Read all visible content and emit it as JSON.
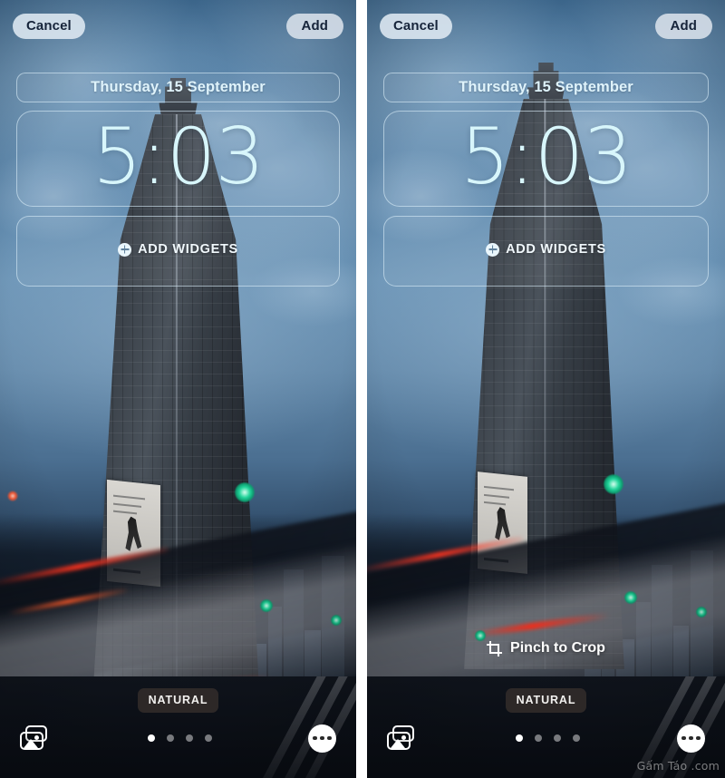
{
  "panels": [
    {
      "id": "left",
      "topbar": {
        "cancel_label": "Cancel",
        "add_label": "Add"
      },
      "date_widget": {
        "text": "Thursday, 15 September"
      },
      "clock_widget": {
        "time": "5:03"
      },
      "add_widgets": {
        "label": "ADD WIDGETS",
        "icon": "plus-circle-icon"
      },
      "pinch_to_crop": {
        "visible": false,
        "label": "Pinch to Crop",
        "icon": "crop-icon"
      },
      "style_badge": {
        "label": "NATURAL"
      },
      "bottom_bar": {
        "photo_library_icon": "photo-library-icon",
        "more_icon": "ellipsis-icon",
        "page_dots": {
          "count": 4,
          "active_index": 0
        }
      },
      "watermark": ""
    },
    {
      "id": "right",
      "topbar": {
        "cancel_label": "Cancel",
        "add_label": "Add"
      },
      "date_widget": {
        "text": "Thursday, 15 September"
      },
      "clock_widget": {
        "time": "5:03"
      },
      "add_widgets": {
        "label": "ADD WIDGETS",
        "icon": "plus-circle-icon"
      },
      "pinch_to_crop": {
        "visible": true,
        "label": "Pinch to Crop",
        "icon": "crop-icon"
      },
      "style_badge": {
        "label": "NATURAL"
      },
      "bottom_bar": {
        "photo_library_icon": "photo-library-icon",
        "more_icon": "ellipsis-icon",
        "page_dots": {
          "count": 4,
          "active_index": 0
        }
      },
      "watermark": "Gấm Táo .com"
    }
  ],
  "colors": {
    "sky_blue": "#5d89ae",
    "clock_text": "#d8f6fb",
    "widget_border": "#d6eaf6",
    "pill_bg": "#dfe9f2",
    "pill_text": "#16243a",
    "badge_bg": "#3a322e",
    "accent_white": "#ffffff",
    "traffic_green": "#21d49a"
  }
}
